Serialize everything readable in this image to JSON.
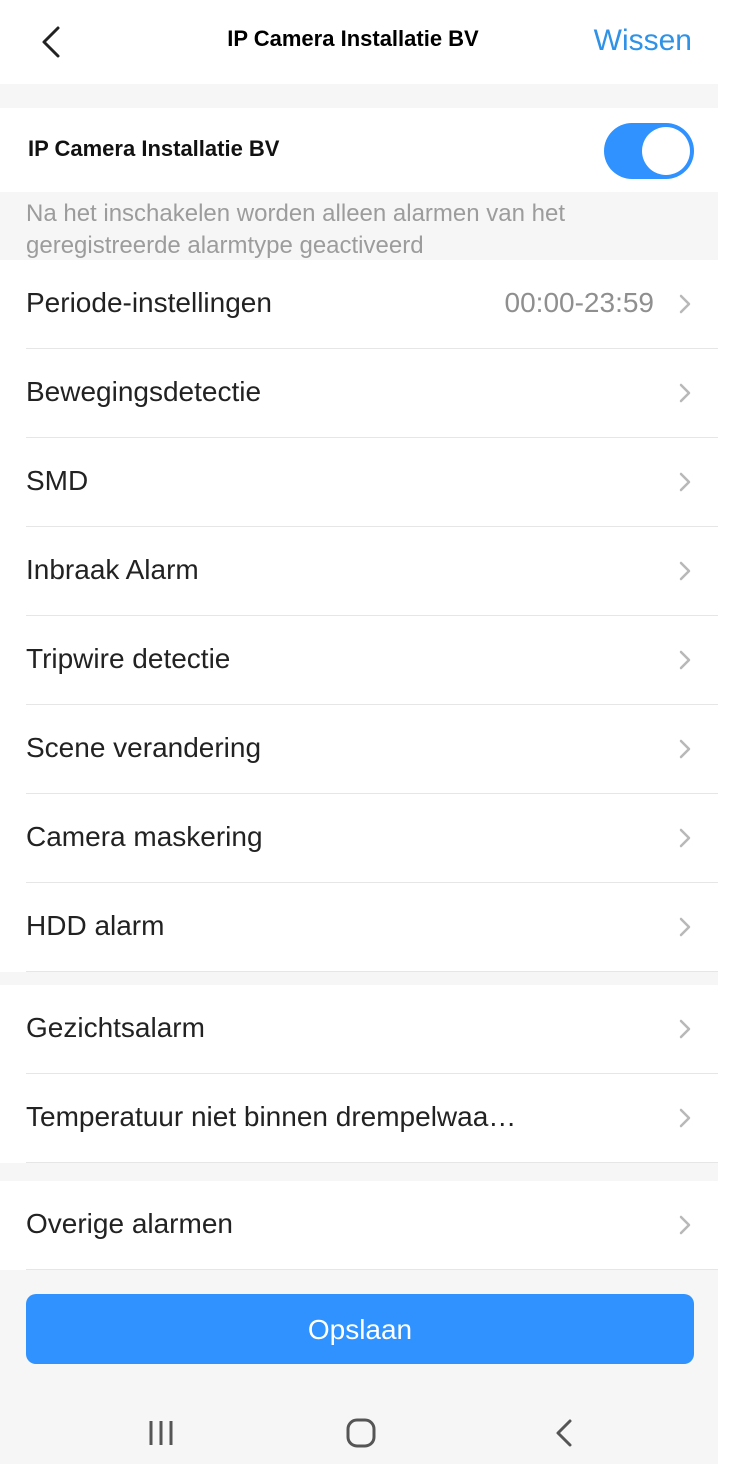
{
  "header": {
    "title": "IP Camera Installatie BV",
    "clear_label": "Wissen"
  },
  "toggle": {
    "label": "IP Camera Installatie BV",
    "enabled": true,
    "accent": "#2f92ff"
  },
  "note": "Na het inschakelen worden alleen alarmen van het geregistreerde alarmtype geactiveerd",
  "groups": [
    {
      "items": [
        {
          "label": "Periode-instellingen",
          "value": "00:00-23:59"
        },
        {
          "label": "Bewegingsdetectie"
        },
        {
          "label": "SMD"
        },
        {
          "label": "Inbraak Alarm"
        },
        {
          "label": "Tripwire detectie"
        },
        {
          "label": "Scene verandering"
        },
        {
          "label": "Camera maskering"
        },
        {
          "label": "HDD alarm"
        }
      ]
    },
    {
      "items": [
        {
          "label": "Gezichtsalarm"
        },
        {
          "label": "Temperatuur niet binnen drempelwaa…"
        }
      ]
    },
    {
      "items": [
        {
          "label": "Overige alarmen"
        }
      ]
    }
  ],
  "save_label": "Opslaan",
  "nav": {
    "icons": [
      "recent-apps-icon",
      "home-icon",
      "back-nav-icon"
    ]
  },
  "colors": {
    "accent": "#2f92ff",
    "link": "#2f92e6",
    "background": "#f6f6f6"
  }
}
